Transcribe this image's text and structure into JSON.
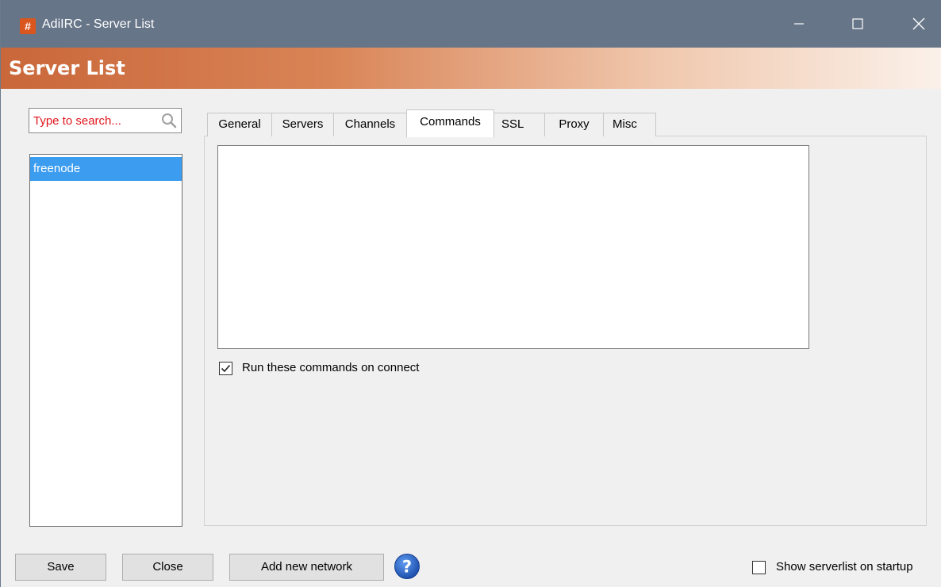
{
  "window": {
    "title": "AdiIRC - Server List",
    "app_icon_glyph": "#",
    "controls": [
      "minimize-icon",
      "maximize-icon",
      "close-icon"
    ]
  },
  "banner": {
    "title": "Server List"
  },
  "search": {
    "placeholder": "Type to search..."
  },
  "networks": [
    {
      "label": "freenode",
      "selected": true
    }
  ],
  "tabs": [
    {
      "label": "General",
      "active": false
    },
    {
      "label": "Servers",
      "active": false
    },
    {
      "label": "Channels",
      "active": false
    },
    {
      "label": "Commands",
      "active": true
    },
    {
      "label": "SSL",
      "active": false
    },
    {
      "label": "Proxy",
      "active": false
    },
    {
      "label": "Misc",
      "active": false
    }
  ],
  "commands_tab": {
    "commands_text": "",
    "run_on_connect_label": "Run these commands on connect",
    "run_on_connect_checked": true
  },
  "footer": {
    "save_label": "Save",
    "close_label": "Close",
    "add_network_label": "Add new network",
    "help_icon": "help-icon",
    "show_on_startup_label": "Show serverlist on startup",
    "show_on_startup_checked": false
  },
  "colors": {
    "titlebar": "#667588",
    "banner_start": "#c9673a",
    "selection": "#3b9cf0",
    "search_placeholder": "#e0151b",
    "help_icon": "#1d5bbf"
  }
}
